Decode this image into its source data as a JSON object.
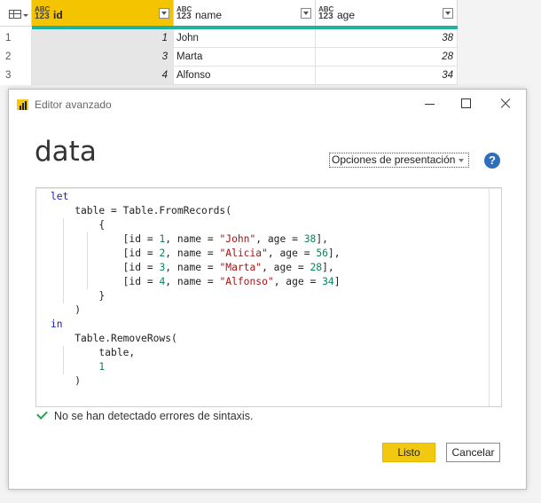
{
  "grid": {
    "columns": [
      {
        "name": "id",
        "type_top": "ABC",
        "type_bottom": "123"
      },
      {
        "name": "name",
        "type_top": "ABC",
        "type_bottom": "123"
      },
      {
        "name": "age",
        "type_top": "ABC",
        "type_bottom": "123"
      }
    ],
    "rows": [
      {
        "n": "1",
        "id": "1",
        "name": "John",
        "age": "38"
      },
      {
        "n": "2",
        "id": "3",
        "name": "Marta",
        "age": "28"
      },
      {
        "n": "3",
        "id": "4",
        "name": "Alfonso",
        "age": "34"
      }
    ],
    "colors": {
      "selected_header": "#f5c400",
      "quality_bar": "#20b2a0"
    }
  },
  "dialog": {
    "window_title": "Editor avanzado",
    "query_name": "data",
    "display_options": "Opciones de presentación",
    "help": "?",
    "code": {
      "lines": [
        "let",
        "    table = Table.FromRecords(",
        "        {",
        "            [id = 1, name = \"John\", age = 38],",
        "            [id = 2, name = \"Alicia\", age = 56],",
        "            [id = 3, name = \"Marta\", age = 28],",
        "            [id = 4, name = \"Alfonso\", age = 34]",
        "        }",
        "    )",
        "in",
        "    Table.RemoveRows(",
        "        table,",
        "        1",
        "    )"
      ]
    },
    "status": "No se han detectado errores de sintaxis.",
    "buttons": {
      "done": "Listo",
      "cancel": "Cancelar"
    },
    "colors": {
      "accent": "#f2c811",
      "keyword": "#1d1db5",
      "string": "#a31515",
      "number": "#098658",
      "ok": "#2e9e50"
    }
  }
}
